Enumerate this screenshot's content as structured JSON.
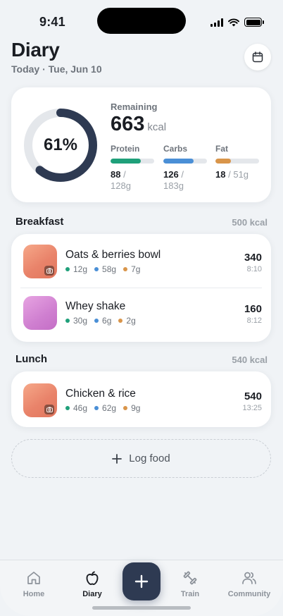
{
  "status_bar": {
    "time": "9:41"
  },
  "header": {
    "title": "Diary",
    "subtitle": "Today · Tue, Jun 10",
    "calendar_icon": "calendar-icon"
  },
  "summary": {
    "percent_label": "61%",
    "percent": 0.61,
    "remaining_label": "Remaining",
    "remaining_value": "663",
    "remaining_unit": "kcal",
    "colors": {
      "ring": "#2e3a52",
      "ring_track": "#e4e7eb"
    },
    "macros": [
      {
        "name": "Protein",
        "value": "88",
        "goal": "128g",
        "separator": "/",
        "fraction": 0.69,
        "color": "#1fa07a"
      },
      {
        "name": "Carbs",
        "value": "126",
        "goal": "183g",
        "separator": "/",
        "fraction": 0.69,
        "color": "#4a8fd6"
      },
      {
        "name": "Fat",
        "value": "18",
        "goal": "51g",
        "separator": "/",
        "fraction": 0.35,
        "color": "#d9954a"
      }
    ]
  },
  "meals": [
    {
      "title": "Breakfast",
      "kcal": "500 kcal",
      "items": [
        {
          "name": "Oats & berries bowl",
          "protein": "12g",
          "carbs": "58g",
          "fat": "7g",
          "kcal": "340",
          "time": "8:10",
          "thumb": "peach",
          "photo_icon": true
        },
        {
          "name": "Whey shake",
          "protein": "30g",
          "carbs": "6g",
          "fat": "2g",
          "kcal": "160",
          "time": "8:12",
          "thumb": "purple",
          "photo_icon": false
        }
      ]
    },
    {
      "title": "Lunch",
      "kcal": "540 kcal",
      "items": [
        {
          "name": "Chicken & rice",
          "protein": "46g",
          "carbs": "62g",
          "fat": "9g",
          "kcal": "540",
          "time": "13:25",
          "thumb": "peach",
          "photo_icon": true
        }
      ]
    }
  ],
  "log_button": {
    "label": "Log food",
    "icon": "plus-icon"
  },
  "tabs": [
    {
      "label": "Home",
      "icon": "home-icon",
      "active": false
    },
    {
      "label": "Diary",
      "icon": "apple-icon",
      "active": true
    },
    {
      "label": "Train",
      "icon": "dumbbell-icon",
      "active": false
    },
    {
      "label": "Community",
      "icon": "people-icon",
      "active": false
    }
  ],
  "fab": {
    "icon": "plus-icon"
  }
}
